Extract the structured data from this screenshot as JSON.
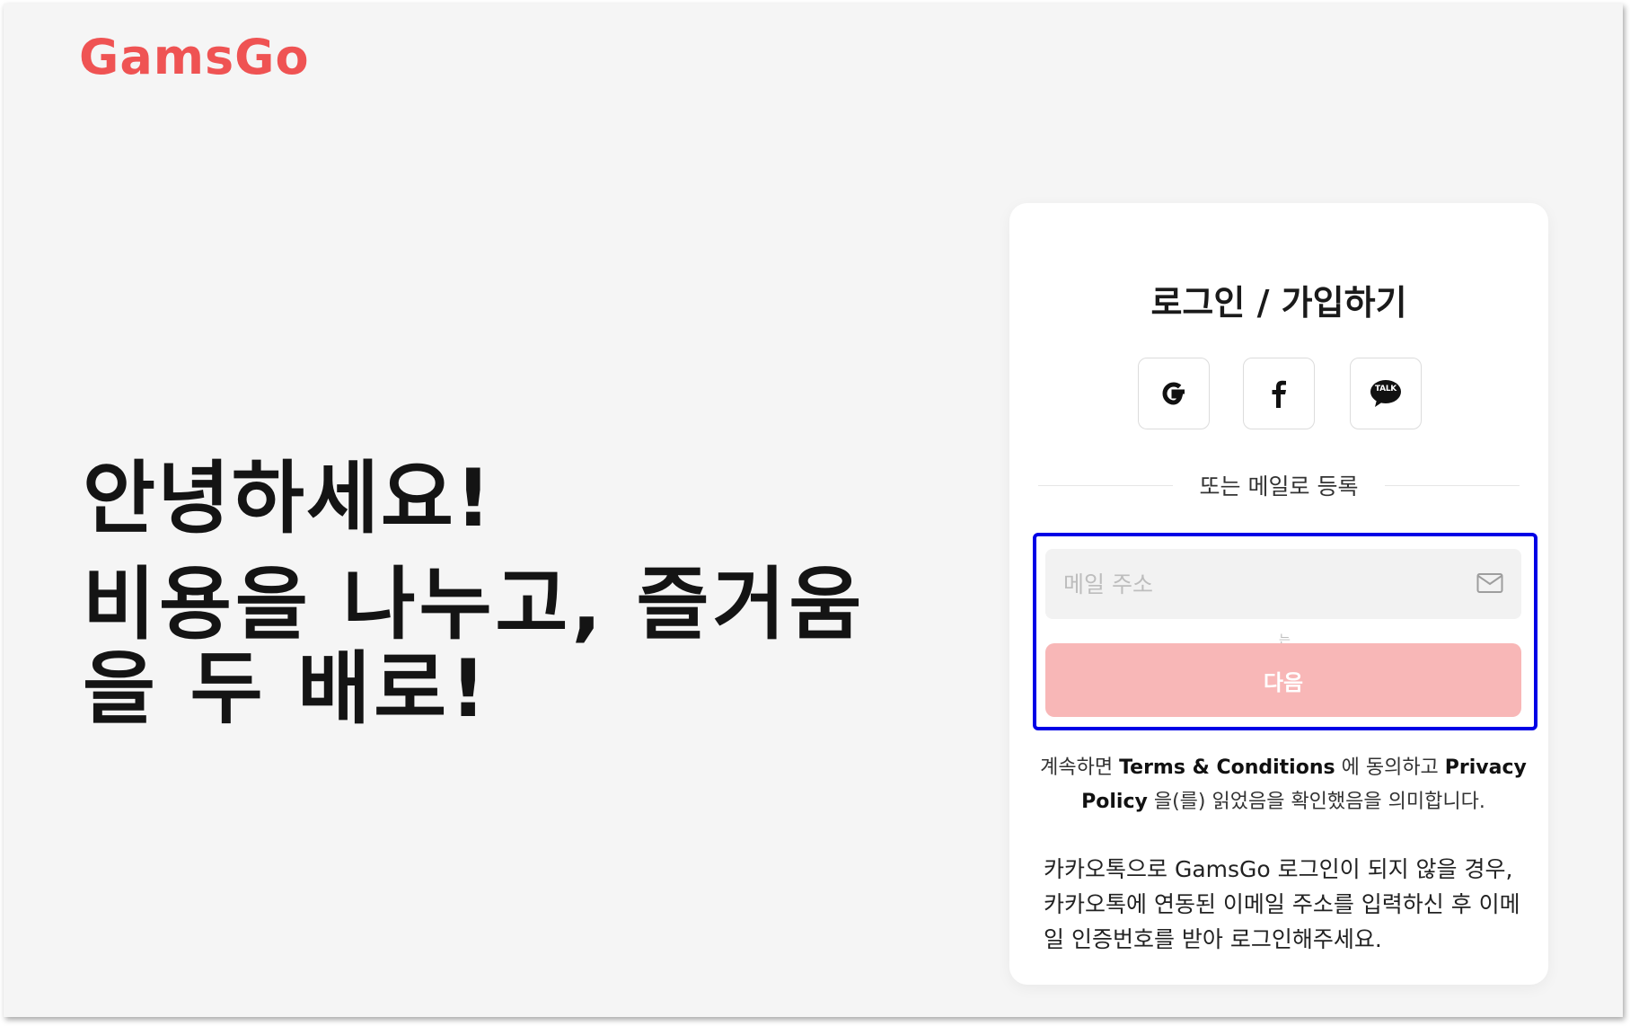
{
  "brand": {
    "logo_text": "GamsGo",
    "accent_color": "#ef5353"
  },
  "hero": {
    "greeting": "안녕하세요!",
    "tagline": "비용을 나누고, 즐거움을 두 배로!"
  },
  "auth_card": {
    "title": "로그인 / 가입하기",
    "social_buttons": [
      {
        "name": "google-login",
        "icon": "google-icon"
      },
      {
        "name": "facebook-login",
        "icon": "facebook-icon"
      },
      {
        "name": "kakaotalk-login",
        "icon": "kakaotalk-icon",
        "icon_label": "TALK"
      }
    ],
    "divider_text": "또는 메일로 등록",
    "email": {
      "placeholder": "메일 주소",
      "value": "",
      "icon": "mail-icon"
    },
    "stray_mark": "는",
    "next_label": "다음",
    "next_button_color": "#f8b7b7",
    "terms": {
      "prefix": "계속하면 ",
      "terms_link": "Terms & Conditions",
      "middle": " 에 동의하고 ",
      "privacy_link": "Privacy Policy",
      "suffix": " 을(를) 읽었음을 확인했음을 의미합니다."
    },
    "kakao_notice": "카카오톡으로 GamsGo 로그인이 되지 않을 경우, 카카오톡에 연동된 이메일 주소를 입력하신 후 이메일 인증번호를 받아 로그인해주세요."
  },
  "annotation": {
    "highlight_color": "#0000e6"
  }
}
